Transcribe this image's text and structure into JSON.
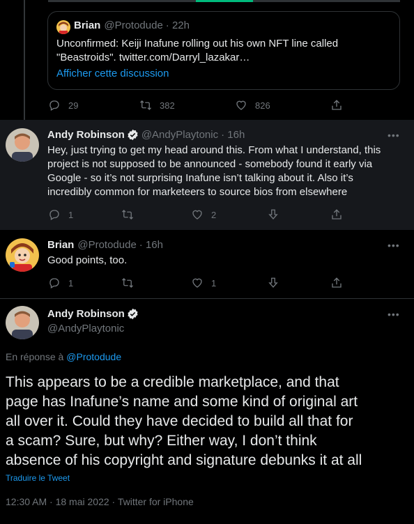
{
  "quoted_tweet": {
    "author_name": "Brian",
    "author_handle": "@Protodude",
    "time": "· 22h",
    "text_line1": "Unconfirmed: Keiji Inafune rolling out his own NFT line called",
    "text_line2": "\"Beastroids\". twitter.com/Darryl_lazakar…",
    "show_thread": "Afficher cette discussion"
  },
  "top_actions": {
    "replies": "29",
    "retweets": "382",
    "likes": "826"
  },
  "reply1": {
    "author_name": "Andy Robinson",
    "author_handle": "@AndyPlaytonic",
    "time": "· 16h",
    "lines": [
      "Hey, just trying to get my head around this. From what I understand, this",
      "project is not supposed to be announced - somebody found it early via",
      "Google - so it’s not surprising Inafune isn’t talking about it. Also it’s",
      "incredibly common for marketeers to source bios from elsewhere"
    ],
    "replies": "1",
    "likes": "2"
  },
  "reply2": {
    "author_name": "Brian",
    "author_handle": "@Protodude",
    "time": "· 16h",
    "text": "Good points, too.",
    "replies": "1",
    "likes": "1"
  },
  "main": {
    "author_name": "Andy Robinson",
    "author_handle": "@AndyPlaytonic",
    "replying_prefix": "En réponse à",
    "replying_to": "@Protodude",
    "lines": [
      "This appears to be a credible marketplace, and that",
      "page has Inafune’s name and some kind of original art",
      "all over it. Could they have decided to build all that for",
      "a scam? Sure, but why? Either way, I don’t think",
      "absence of his copyright and signature debunks it at all"
    ],
    "translate": "Traduire le Tweet",
    "timestamp": "12:30 AM · 18 mai 2022 · Twitter for iPhone"
  },
  "colors": {
    "accent": "#1d9bf0",
    "muted": "#71767b",
    "text": "#e7e9ea",
    "border": "#2f3336",
    "background": "#000000"
  }
}
